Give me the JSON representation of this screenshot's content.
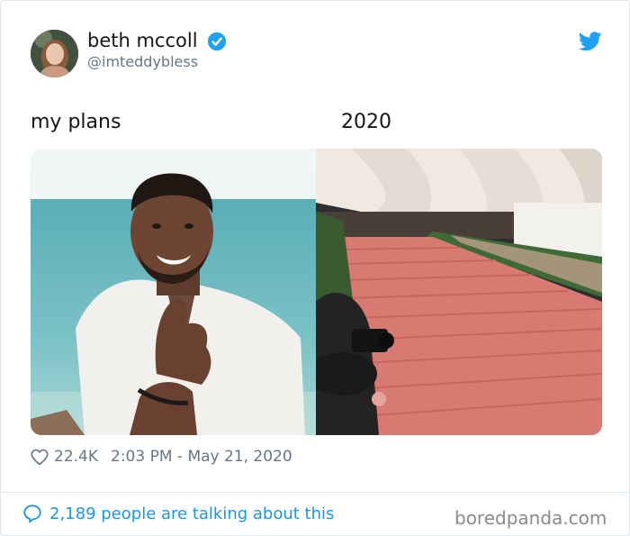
{
  "tweet": {
    "display_name": "beth mccoll",
    "handle": "@imteddybless",
    "caption_left": "my plans",
    "caption_right": "2020",
    "likes": "22.4K",
    "timestamp": "2:03 PM - May 21, 2020",
    "talking": "2,189 people are talking about this"
  },
  "watermark": "boredpanda.com",
  "icons": {
    "verified": "verified-badge-icon",
    "brand": "twitter-bird-icon",
    "like": "heart-icon",
    "reply": "speech-bubble-icon"
  },
  "colors": {
    "accent": "#1b95e0",
    "verified": "#1da1f2",
    "muted": "#657786",
    "carpet": "#d97a72"
  }
}
